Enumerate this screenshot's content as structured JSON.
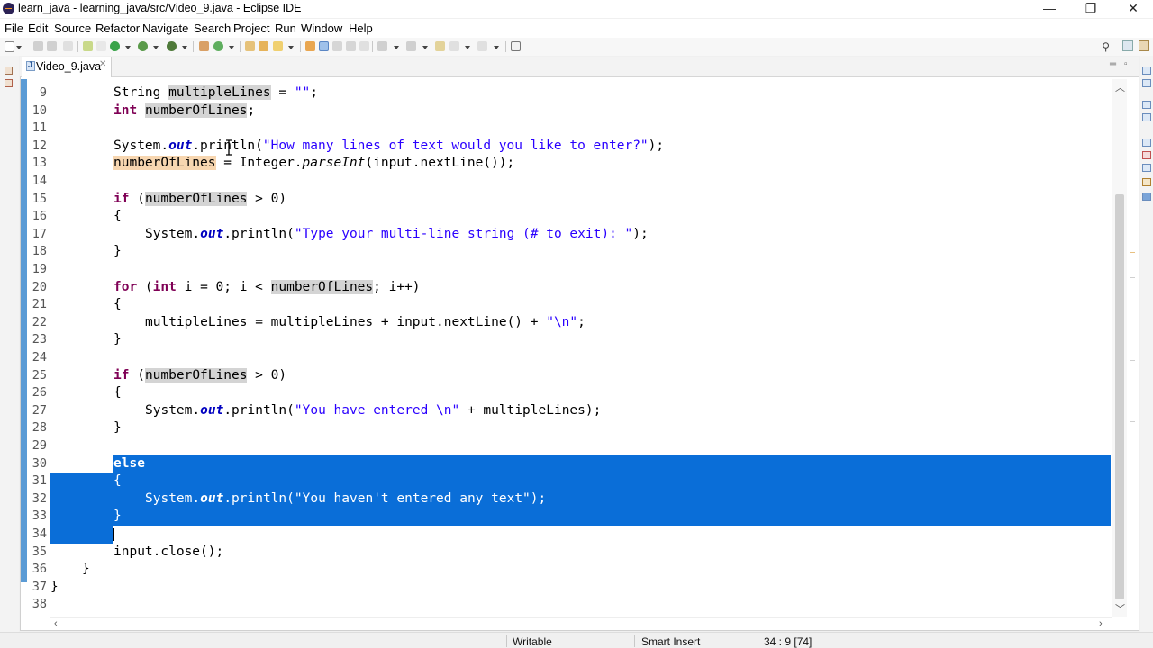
{
  "window": {
    "title": "learn_java - learning_java/src/Video_9.java - Eclipse IDE",
    "controls": {
      "minimize": "—",
      "restore": "❐",
      "close": "✕"
    }
  },
  "menubar": {
    "items": [
      "File",
      "Edit",
      "Source",
      "Refactor",
      "Navigate",
      "Search",
      "Project",
      "Run",
      "Window",
      "Help"
    ]
  },
  "editor": {
    "tab": {
      "label": "Video_9.java",
      "close": "✕",
      "icon": "java-file-icon"
    },
    "line_numbers": [
      "9",
      "10",
      "11",
      "12",
      "13",
      "14",
      "15",
      "16",
      "17",
      "18",
      "19",
      "20",
      "21",
      "22",
      "23",
      "24",
      "25",
      "26",
      "27",
      "28",
      "29",
      "30",
      "31",
      "32",
      "33",
      "34",
      "35",
      "36",
      "37",
      "38"
    ],
    "code": {
      "l9": {
        "type": "String",
        "var": "multipleLines",
        "rest": " = ",
        "str": "\"\"",
        "end": ";"
      },
      "l10": {
        "kw": "int",
        "var": "numberOfLines",
        "end": ";"
      },
      "l12": {
        "cls": "System.",
        "fld": "out",
        "call": ".println(",
        "str": "\"How many lines of text would you like to enter?\"",
        "end": ");"
      },
      "l13": {
        "var": "numberOfLines",
        "mid": " = Integer.",
        "st": "parseInt",
        "end": "(input.nextLine());"
      },
      "l15": {
        "kw": "if",
        "open": " (",
        "var": "numberOfLines",
        "end": " > 0)"
      },
      "l16": "{",
      "l17": {
        "cls": "System.",
        "fld": "out",
        "call": ".println(",
        "str": "\"Type your multi-line string (# to exit): \"",
        "end": ");"
      },
      "l18": "}",
      "l20": {
        "kw": "for",
        "open": " (",
        "kw2": "int",
        "mid": " i = 0; i < ",
        "var": "numberOfLines",
        "end": "; i++)"
      },
      "l21": "{",
      "l22": {
        "pre": "multipleLines = multipleLines + input.nextLine() + ",
        "str": "\"\\n\"",
        "end": ";"
      },
      "l23": "}",
      "l25": {
        "kw": "if",
        "open": " (",
        "var": "numberOfLines",
        "end": " > 0)"
      },
      "l26": "{",
      "l27": {
        "cls": "System.",
        "fld": "out",
        "call": ".println(",
        "str": "\"You have entered \\n\"",
        "end": " + multipleLines);"
      },
      "l28": "}",
      "l30": {
        "kw": "else"
      },
      "l31": "{",
      "l32": {
        "cls": "System.",
        "fld": "out",
        "call": ".println(",
        "str": "\"You haven't entered any text\"",
        "end": ");"
      },
      "l33": "}",
      "l35": "input.close();",
      "l36": "}",
      "l37": "}"
    }
  },
  "statusbar": {
    "mode": "Writable",
    "insert": "Smart Insert",
    "position": "34 : 9 [74]"
  },
  "colors": {
    "selection": "#0a6ed8",
    "keyword": "#7f0055",
    "string": "#2a00ff",
    "field": "#0000c0",
    "change_bar": "#5b9bd5"
  }
}
